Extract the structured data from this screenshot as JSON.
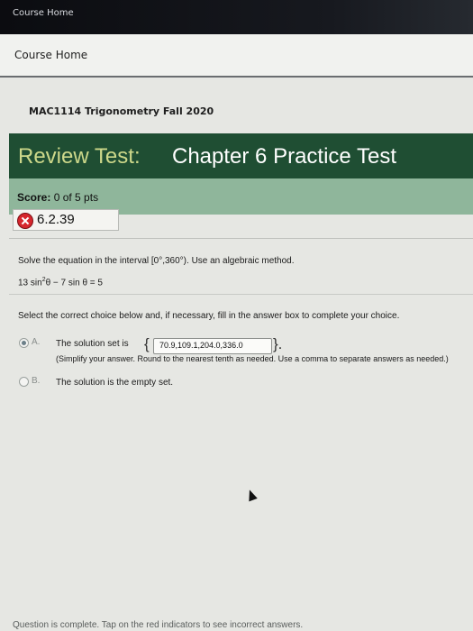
{
  "topbar": {
    "title": "Course Home"
  },
  "subnav": {
    "link": "Course Home"
  },
  "course": {
    "name": "MAC1114 Trigonometry Fall 2020"
  },
  "test": {
    "title_prefix": "Review Test:",
    "title_main": "Chapter 6 Practice Test",
    "score_label": "Score:",
    "score_value": "0 of 5 pts"
  },
  "question": {
    "number": "6.2.39",
    "status": "incorrect",
    "instructions": "Solve the equation in the interval [0°,360°). Use an algebraic method.",
    "equation_part1": "13 sin",
    "equation_exp": "2",
    "equation_part2": "θ − 7 sin θ = 5",
    "select_text": "Select the correct choice below and, if necessary, fill in the answer box to complete your choice."
  },
  "choices": {
    "a": {
      "letter": "A.",
      "text": "The solution set is",
      "answer": "70.9,109.1,204.0,336.0",
      "open_brace": "{",
      "close_brace": "}.",
      "hint": "(Simplify your answer. Round to the nearest tenth as needed. Use a comma to separate answers as needed.)",
      "selected": true
    },
    "b": {
      "letter": "B.",
      "text": "The solution is the empty set.",
      "selected": false
    }
  },
  "footer": {
    "text": "Question is complete. Tap on the red indicators to see incorrect answers."
  },
  "colors": {
    "title_bar": "#1f4e33",
    "score_bar": "#8fb69b",
    "incorrect": "#d6262d"
  }
}
